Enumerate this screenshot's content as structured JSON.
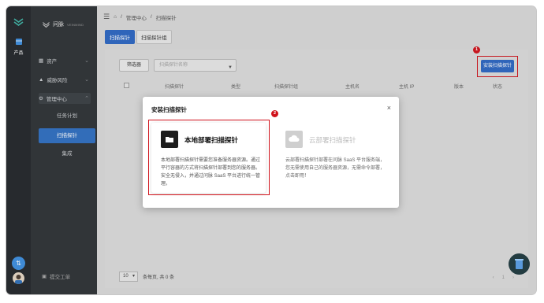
{
  "rail": {
    "product_label": "产品",
    "switch_glyph": "⇅"
  },
  "sidebar": {
    "brand": "问脉",
    "brand_sub": "VEINMIND",
    "items": [
      {
        "label": "资产"
      },
      {
        "label": "威胁风险"
      },
      {
        "label": "管理中心"
      }
    ],
    "sub_items": [
      {
        "label": "任务计划"
      },
      {
        "label": "扫描探针"
      },
      {
        "label": "集成"
      }
    ],
    "ticket": "提交工单"
  },
  "breadcrumb": {
    "home": "⌂",
    "sep1": "/",
    "level1": "管理中心",
    "sep2": "/",
    "level2": "扫描探针"
  },
  "tabs": [
    {
      "label": "扫描探针"
    },
    {
      "label": "扫描探针组"
    }
  ],
  "toolbar": {
    "filter_label": "筛选器",
    "search_placeholder": "扫描探针名称",
    "install_label": "安装扫描探针"
  },
  "table": {
    "columns": [
      "扫描探针",
      "类型",
      "扫描探针组",
      "主机名",
      "主机 IP",
      "版本",
      "状态"
    ]
  },
  "pagination": {
    "page_size": "10",
    "summary": "条每页, 共 0 条",
    "prev": "‹",
    "page": "1",
    "next": "›"
  },
  "modal": {
    "title": "安装扫描探针",
    "close": "×",
    "options": [
      {
        "name": "本地部署扫描探针",
        "desc": "本地部署扫描探针需要您准备服务器资源。通过平行容器的方式将扫描探针部署到您的服务器。安全无侵入，并通过问脉 SaaS 平台进行统一管理。"
      },
      {
        "name": "云部署扫描探针",
        "desc": "云部署扫描探针部署在问脉 SaaS 平台服务端，您无需使用自己的服务器资源，无需命令部署，点击即用！"
      }
    ]
  },
  "annotations": {
    "badge1": "1",
    "badge2": "2"
  },
  "colors": {
    "accent": "#2c67c3",
    "highlight": "#d0121b",
    "rail": "#23272b",
    "sidebar": "#2e3236"
  }
}
